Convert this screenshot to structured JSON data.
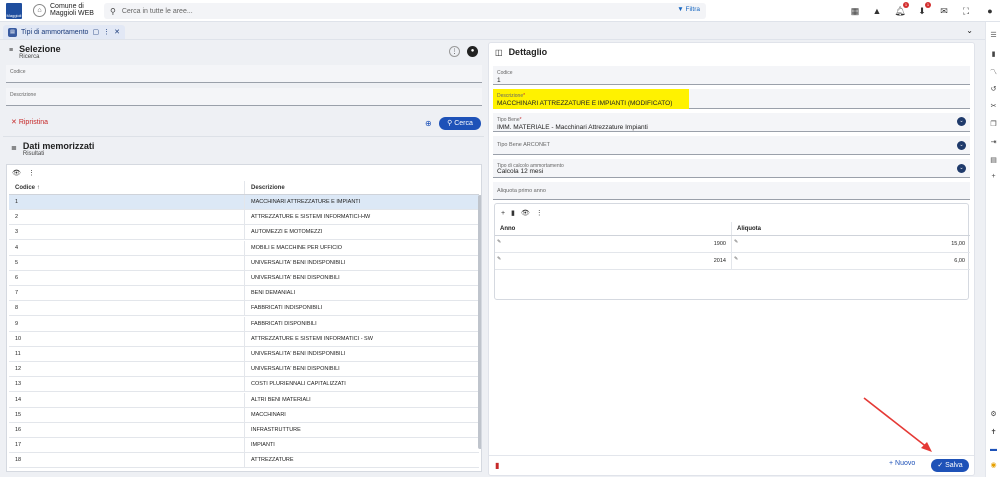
{
  "header": {
    "logo_text": "Maggioli",
    "org_name_line1": "Comune di",
    "org_name_line2": "Maggioli WEB",
    "search_placeholder": "Cerca in tutte le aree...",
    "filter_label": "Filtra",
    "notification_count": "1",
    "download_count": "1"
  },
  "tab": {
    "label": "Tipi di ammortamento"
  },
  "selezione": {
    "title": "Selezione",
    "subtitle": "Ricerca",
    "codice_label": "Codice",
    "descrizione_label": "Descrizione",
    "ripristina_label": "Ripristina",
    "cerca_label": "Cerca"
  },
  "dati": {
    "title": "Dati memorizzati",
    "subtitle": "Risultati",
    "col_codice": "Codice",
    "col_descrizione": "Descrizione",
    "rows": [
      {
        "codice": "1",
        "descrizione": "MACCHINARI ATTREZZATURE E IMPIANTI"
      },
      {
        "codice": "2",
        "descrizione": "ATTREZZATURE E SISTEMI INFORMATICI-HW"
      },
      {
        "codice": "3",
        "descrizione": "AUTOMEZZI E MOTOMEZZI"
      },
      {
        "codice": "4",
        "descrizione": "MOBILI E MACCHINE PER UFFICIO"
      },
      {
        "codice": "5",
        "descrizione": "UNIVERSALITA' BENI INDISPONIBILI"
      },
      {
        "codice": "6",
        "descrizione": "UNIVERSALITA' BENI DISPONIBILI"
      },
      {
        "codice": "7",
        "descrizione": "BENI DEMANIALI"
      },
      {
        "codice": "8",
        "descrizione": "FABBRICATI INDISPONIBILI"
      },
      {
        "codice": "9",
        "descrizione": "FABBRICATI DISPONIBILI"
      },
      {
        "codice": "10",
        "descrizione": "ATTREZZATURE E SISTEMI INFORMATICI - SW"
      },
      {
        "codice": "11",
        "descrizione": "UNIVERSALITA' BENI INDISPONIBILI"
      },
      {
        "codice": "12",
        "descrizione": "UNIVERSALITA' BENI DISPONIBILI"
      },
      {
        "codice": "13",
        "descrizione": "COSTI PLURIENNALI CAPITALIZZATI"
      },
      {
        "codice": "14",
        "descrizione": "ALTRI BENI MATERIALI"
      },
      {
        "codice": "15",
        "descrizione": "MACCHINARI"
      },
      {
        "codice": "16",
        "descrizione": "INFRASTRUTTURE"
      },
      {
        "codice": "17",
        "descrizione": "IMPIANTI"
      },
      {
        "codice": "18",
        "descrizione": "ATTREZZATURE"
      }
    ]
  },
  "dettaglio": {
    "title": "Dettaglio",
    "codice_label": "Codice",
    "codice_value": "1",
    "descrizione_label": "Descrizione",
    "descrizione_value": "MACCHINARI ATTREZZATURE E IMPIANTI (MODIFICATO)",
    "tipo_bene_label": "Tipo Bene",
    "tipo_bene_value": "IMM. MATERIALE - Macchinari Attrezzature Impianti",
    "tipo_bene_arconet_label": "Tipo Bene ARCONET",
    "tipo_calcolo_label": "Tipo di calcolo ammortamento",
    "tipo_calcolo_value": "Calcola 12 mesi",
    "aliquota_primo_anno_label": "Aliquota primo anno",
    "subgrid": {
      "col_anno": "Anno",
      "col_aliquota": "Aliquota",
      "rows": [
        {
          "anno": "1900",
          "aliquota": "15,00"
        },
        {
          "anno": "2014",
          "aliquota": "6,00"
        }
      ]
    },
    "nuovo_label": "Nuovo",
    "salva_label": "Salva"
  },
  "colors": {
    "primary": "#1e52b8",
    "highlight": "#fff200",
    "danger": "#c62828",
    "annotation_arrow": "#e53935"
  }
}
